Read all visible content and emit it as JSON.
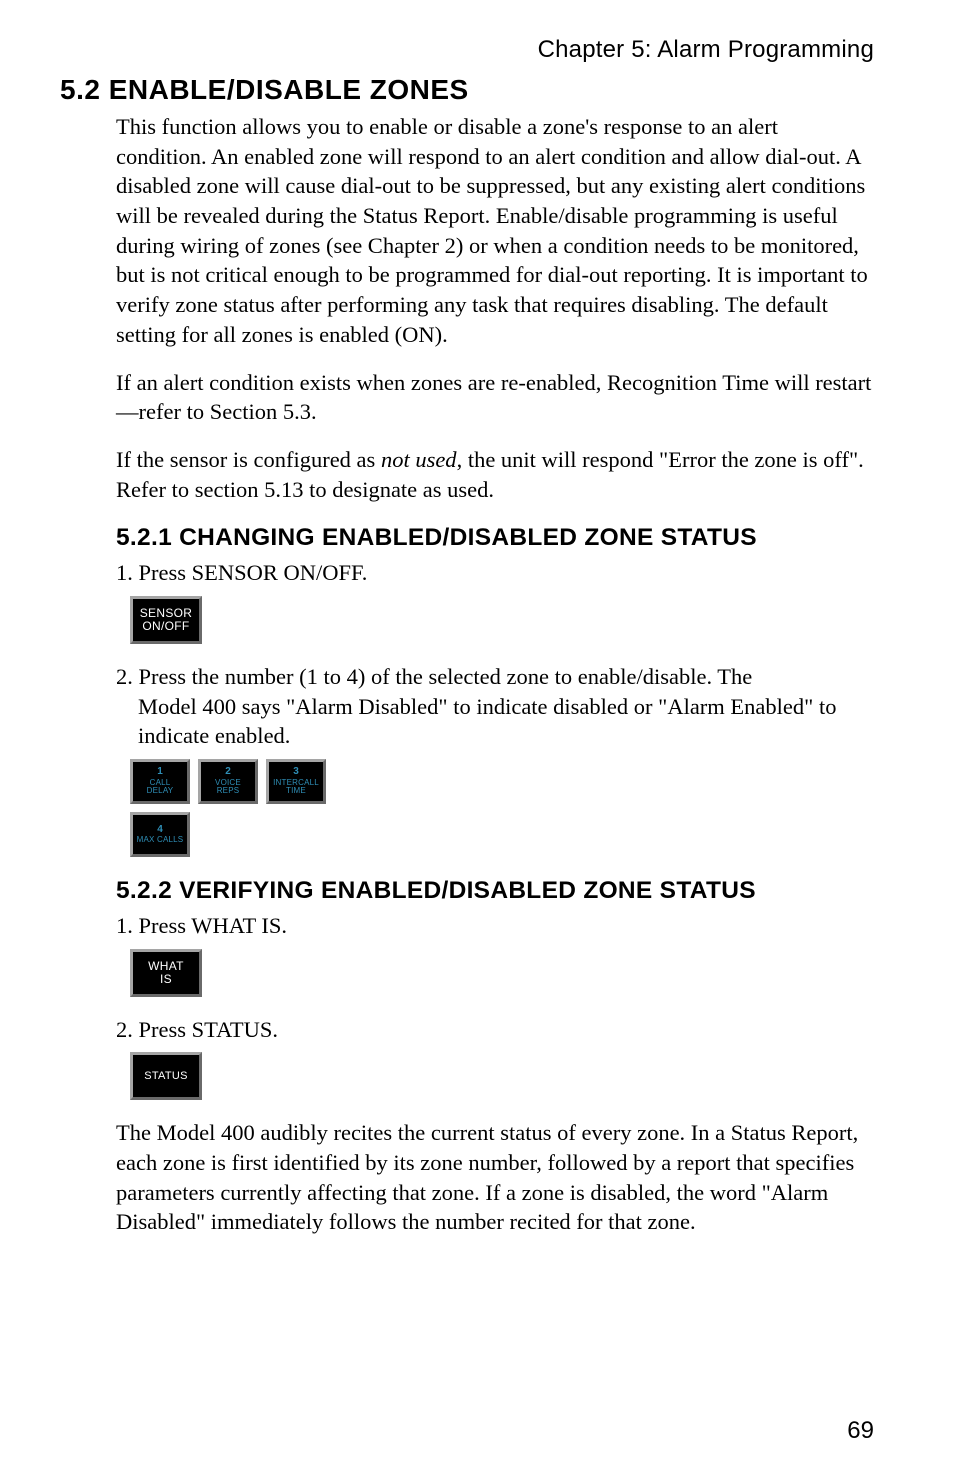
{
  "chapter": "Chapter 5: Alarm Programming",
  "section": {
    "num_title": "5.2 ENABLE/DISABLE ZONES",
    "p1": "This function allows you to enable or disable a zone's response to an alert condition. An enabled zone will respond to an alert condition and allow dial-out. A disabled zone will cause dial-out to be suppressed, but any existing alert conditions will be revealed during the Status Report. Enable/disable programming is useful during wiring of zones (see Chapter 2) or when a condition needs to be monitored, but is not critical enough to be programmed for dial-out reporting. It is important to verify zone status after performing any task that requires disabling. The default setting for all zones is enabled (ON).",
    "p2": "If an alert condition exists when zones are re-enabled, Recognition Time will restart—refer to Section 5.3.",
    "p3_a": "If the sensor is configured as ",
    "p3_i": "not used",
    "p3_b": ", the unit will respond \"Error the zone is off\". Refer to section 5.13 to designate as used."
  },
  "sub1": {
    "title": "5.2.1 CHANGING ENABLED/DISABLED ZONE STATUS",
    "step1": "1. Press SENSOR ON/OFF.",
    "sensor_key": {
      "l1": "SENSOR",
      "l2": "ON/OFF"
    },
    "step2_line1": "2. Press the number (1 to 4) of the selected zone to enable/disable. The",
    "step2_line2": "Model 400 says \"Alarm Disabled\" to indicate disabled or \"Alarm Enabled\" to indicate enabled.",
    "numkeys": [
      {
        "num": "1",
        "l1": "CALL",
        "l2": "DELAY"
      },
      {
        "num": "2",
        "l1": "VOICE",
        "l2": "REPS"
      },
      {
        "num": "3",
        "l1": "INTERCALL",
        "l2": "TIME"
      },
      {
        "num": "4",
        "l1": "MAX CALLS",
        "l2": ""
      }
    ]
  },
  "sub2": {
    "title": "5.2.2 VERIFYING ENABLED/DISABLED ZONE STATUS",
    "step1": "1. Press WHAT IS.",
    "whatis_key": {
      "l1": "WHAT",
      "l2": "IS"
    },
    "step2": "2. Press STATUS.",
    "status_key": {
      "l1": "STATUS"
    },
    "p": "The Model 400 audibly recites the current status of every zone. In a Status Report, each zone is first identified by its zone number, followed by a report that specifies parameters currently affecting that zone. If a zone is disabled, the word \"Alarm Disabled\" immediately follows the number recited for that zone."
  },
  "page": "69"
}
